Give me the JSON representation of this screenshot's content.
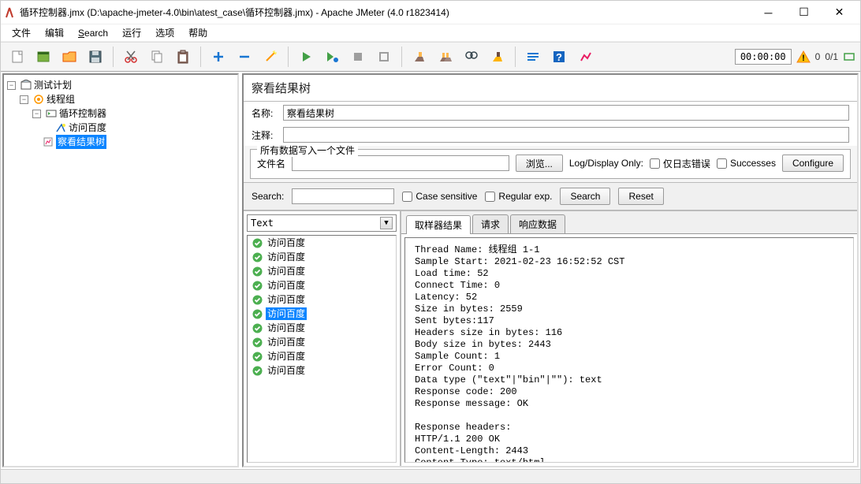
{
  "window": {
    "title": "循环控制器.jmx (D:\\apache-jmeter-4.0\\bin\\atest_case\\循环控制器.jmx) - Apache JMeter (4.0 r1823414)"
  },
  "menu": [
    "文件",
    "编辑",
    "Search",
    "运行",
    "选项",
    "帮助"
  ],
  "menu_ul": [
    "",
    "",
    "S",
    "",
    "",
    ""
  ],
  "toolbar": {
    "timer": "00:00:00",
    "counter": "0",
    "counter_total": "0/1"
  },
  "tree": {
    "root": {
      "label": "测试计划"
    },
    "thread_group": {
      "label": "线程组"
    },
    "loop_controller": {
      "label": "循环控制器"
    },
    "http": {
      "label": "访问百度"
    },
    "result_tree": {
      "label": "察看结果树"
    }
  },
  "panel": {
    "title": "察看结果树",
    "name_label": "名称:",
    "name_value": "察看结果树",
    "comment_label": "注释:",
    "comment_value": "",
    "file_group": "所有数据写入一个文件",
    "file_label": "文件名",
    "file_value": "",
    "browse_btn": "浏览...",
    "log_display": "Log/Display Only:",
    "errors_only": "仅日志错误",
    "successes": "Successes",
    "configure": "Configure"
  },
  "search_row": {
    "label": "Search:",
    "case_sensitive": "Case sensitive",
    "regular_exp": "Regular exp.",
    "search_btn": "Search",
    "reset_btn": "Reset"
  },
  "results": {
    "combo": "Text",
    "items": [
      "访问百度",
      "访问百度",
      "访问百度",
      "访问百度",
      "访问百度",
      "访问百度",
      "访问百度",
      "访问百度",
      "访问百度",
      "访问百度"
    ],
    "selected_index": 5
  },
  "tabs": [
    "取样器结果",
    "请求",
    "响应数据"
  ],
  "details_text": "Thread Name: 线程组 1-1\nSample Start: 2021-02-23 16:52:52 CST\nLoad time: 52\nConnect Time: 0\nLatency: 52\nSize in bytes: 2559\nSent bytes:117\nHeaders size in bytes: 116\nBody size in bytes: 2443\nSample Count: 1\nError Count: 0\nData type (\"text\"|\"bin\"|\"\"): text\nResponse code: 200\nResponse message: OK\n\nResponse headers:\nHTTP/1.1 200 OK\nContent-Length: 2443\nContent-Type: text/html"
}
